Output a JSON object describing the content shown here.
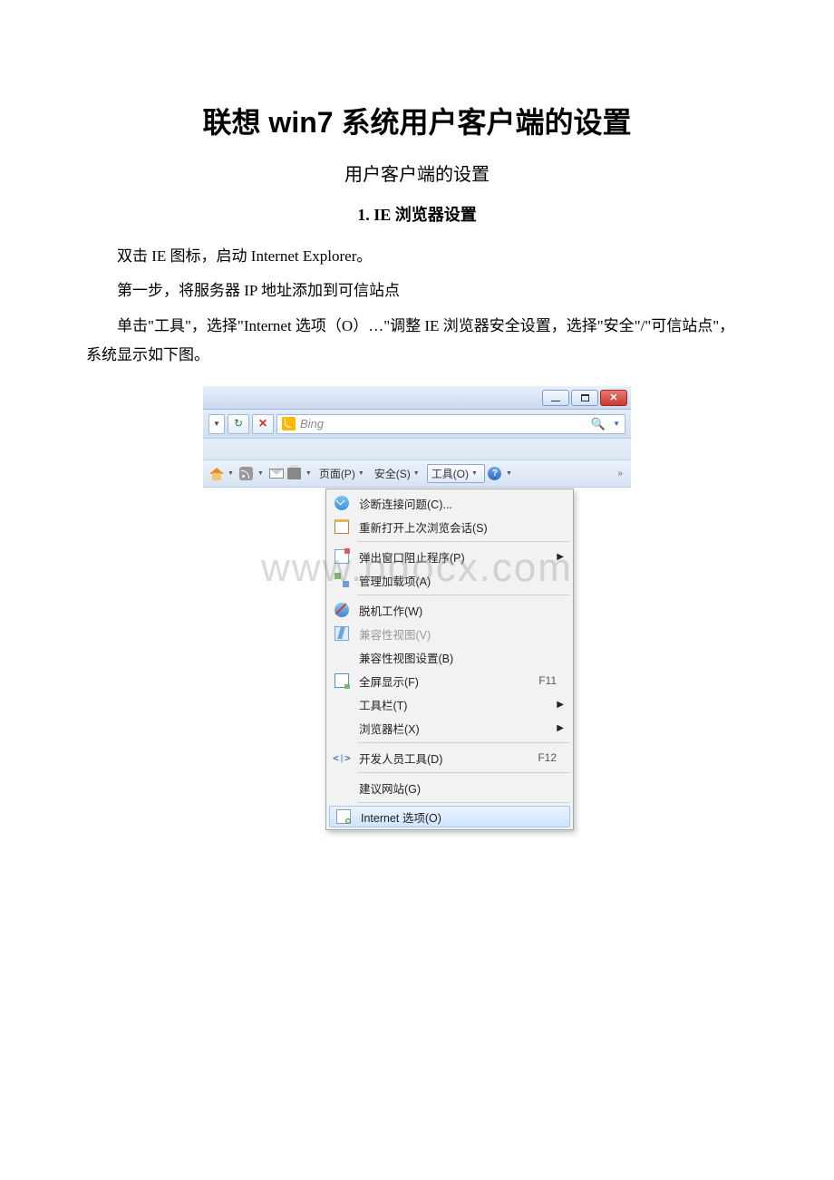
{
  "doc": {
    "title": "联想 win7 系统用户客户端的设置",
    "subtitle": "用户客户端的设置",
    "section": "1.  IE 浏览器设置",
    "p1": "双击 IE 图标，启动 Internet Explorer。",
    "p2": "第一步，将服务器 IP 地址添加到可信站点",
    "p3": "单击\"工具\"，选择\"Internet 选项（O）…\"调整 IE 浏览器安全设置，选择\"安全\"/\"可信站点\"，系统显示如下图。"
  },
  "search": {
    "placeholder": "Bing"
  },
  "toolbar": {
    "page": "页面(P)",
    "safety": "安全(S)",
    "tools": "工具(O)"
  },
  "menu": {
    "diag": "诊断连接问题(C)...",
    "reopen": "重新打开上次浏览会话(S)",
    "popup": "弹出窗口阻止程序(P)",
    "addons": "管理加载项(A)",
    "offline": "脱机工作(W)",
    "compat_view": "兼容性视图(V)",
    "compat_settings": "兼容性视图设置(B)",
    "fullscreen": "全屏显示(F)",
    "fullscreen_key": "F11",
    "toolbars": "工具栏(T)",
    "explorer_bars": "浏览器栏(X)",
    "devtools": "开发人员工具(D)",
    "devtools_key": "F12",
    "suggested": "建议网站(G)",
    "inetopts": "Internet 选项(O)"
  },
  "watermark": "www.bdocx.com"
}
